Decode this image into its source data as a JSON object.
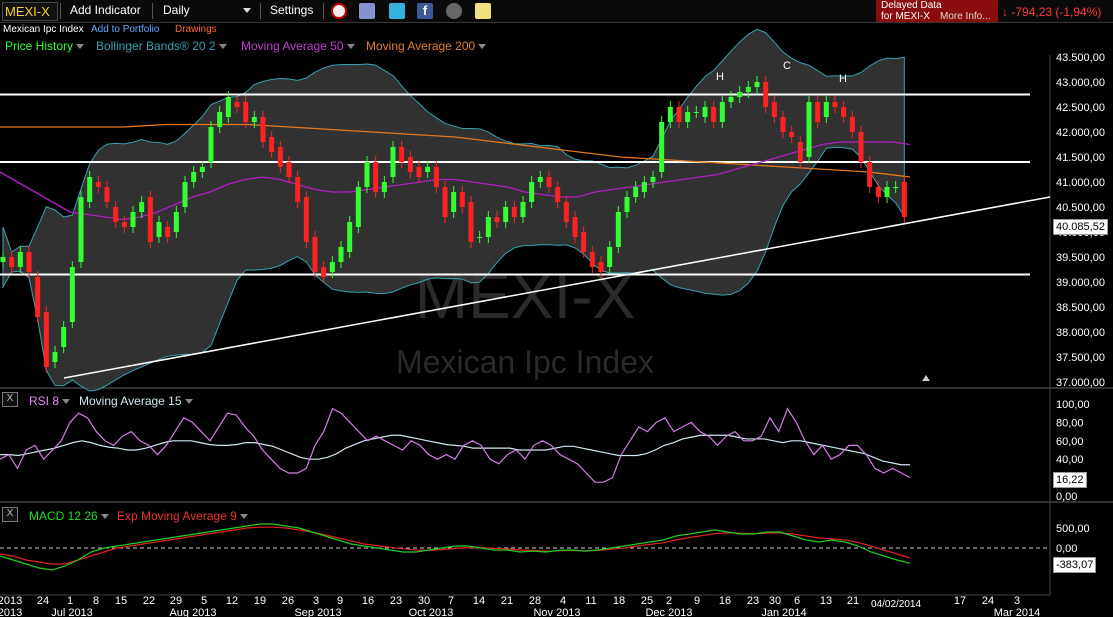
{
  "toolbar": {
    "symbol": "MEXI-X",
    "add_indicator": "Add Indicator",
    "interval": "Daily",
    "settings": "Settings"
  },
  "subheader": {
    "name": "Mexican Ipc Index",
    "add_portfolio": "Add to Portfolio",
    "drawings": "Drawings"
  },
  "delayed": {
    "line1": "Delayed Data",
    "line2": "for MEXI-X",
    "more": "More Info..."
  },
  "change": "-794,23 (-1,94%)",
  "legend": {
    "price": "Price History",
    "bb": "Bollinger Bands® 20 2",
    "ma50": "Moving Average 50",
    "ma200": "Moving Average 200"
  },
  "watermark": {
    "symbol": "MEXI-X",
    "name": "Mexican Ipc Index"
  },
  "annotations": [
    "H",
    "C",
    "H"
  ],
  "rsi_panel": {
    "close": "X",
    "label": "RSI 8",
    "ma": "Moving Average 15"
  },
  "macd_panel": {
    "close": "X",
    "label": "MACD 12 26",
    "signal": "Exp Moving Average 9"
  },
  "last_labels": {
    "price": "40.085,52",
    "rsi": "16,22",
    "macd": "-383,07"
  },
  "cursor_date": "04/02/2014",
  "colors": {
    "up": "#33ff33",
    "down": "#ff2222",
    "ma50": "#b020c0",
    "ma200": "#e07820",
    "bb": "#3aa0b0",
    "rsi": "#d080e0",
    "rsi_ma": "#cfe8f0",
    "macd": "#22cc22",
    "signal": "#dd2222"
  },
  "chart_data": [
    {
      "type": "candlestick",
      "ylim": [
        37000,
        43500
      ],
      "y_ticks": [
        "43.500,00",
        "43.000,00",
        "42.500,00",
        "42.000,00",
        "41.500,00",
        "41.000,00",
        "40.500,00",
        "40.000,00",
        "39.500,00",
        "39.000,00",
        "38.500,00",
        "38.000,00",
        "37.500,00",
        "37.000,00"
      ],
      "x_ticks": [
        "2013",
        "24",
        "1",
        "8",
        "15",
        "22",
        "29",
        "5",
        "12",
        "19",
        "26",
        "3",
        "9",
        "16",
        "23",
        "30",
        "7",
        "14",
        "21",
        "28",
        "4",
        "11",
        "18",
        "25",
        "2",
        "9",
        "16",
        "23",
        "30",
        "6",
        "13",
        "21",
        "",
        "17",
        "24",
        "3"
      ],
      "month_labels": [
        "2013",
        "Jul 2013",
        "Aug 2013",
        "Sep 2013",
        "Oct 2013",
        "Nov 2013",
        "Dec 2013",
        "Jan 2014",
        "Mar 2014"
      ],
      "horizontal_levels": [
        42750,
        41400,
        39150
      ],
      "trendline": {
        "start_value": 37080,
        "end_value": 40700
      },
      "close": [
        39500,
        39300,
        39600,
        39200,
        38300,
        37300,
        37600,
        38100,
        39300,
        40700,
        41100,
        40900,
        40600,
        40200,
        40100,
        40400,
        40600,
        39800,
        40200,
        39900,
        40400,
        41000,
        41200,
        41300,
        42100,
        42400,
        42700,
        42500,
        42200,
        42300,
        41800,
        41600,
        41300,
        41100,
        40600,
        39800,
        39200,
        39100,
        39400,
        39700,
        40200,
        40900,
        41400,
        40800,
        41000,
        41700,
        41400,
        41200,
        41100,
        41300,
        40900,
        40300,
        40800,
        40500,
        39800,
        39900,
        40300,
        40200,
        40500,
        40300,
        40600,
        41000,
        41100,
        40900,
        40600,
        40200,
        39900,
        39600,
        39300,
        39200,
        39700,
        40400,
        40700,
        40900,
        41000,
        41100,
        42200,
        42500,
        42200,
        42400,
        42400,
        42500,
        42200,
        42600,
        42700,
        42800,
        42900,
        43000,
        42500,
        42300,
        42000,
        41900,
        41400,
        42600,
        42200,
        42600,
        42500,
        42300,
        42000,
        41400,
        40900,
        40700,
        40900,
        40900,
        40300
      ],
      "open": [
        39400,
        39500,
        39300,
        39600,
        39100,
        38400,
        37400,
        37700,
        38200,
        39400,
        40600,
        41000,
        40900,
        40500,
        40200,
        40100,
        40400,
        40700,
        39900,
        40100,
        40000,
        40500,
        41000,
        41200,
        41400,
        42100,
        42300,
        42600,
        42600,
        42200,
        42300,
        41900,
        41700,
        41400,
        41100,
        40700,
        39900,
        39300,
        39200,
        39400,
        39600,
        40100,
        40900,
        41400,
        40800,
        41100,
        41700,
        41500,
        41300,
        41200,
        41300,
        40900,
        40400,
        40800,
        40600,
        39900,
        39900,
        40300,
        40200,
        40500,
        40300,
        40600,
        41000,
        41100,
        40900,
        40600,
        40300,
        40000,
        39600,
        39400,
        39300,
        39700,
        40400,
        40700,
        40800,
        41000,
        41200,
        42200,
        42500,
        42200,
        42400,
        42300,
        42500,
        42200,
        42600,
        42700,
        42800,
        42900,
        43000,
        42600,
        42300,
        42000,
        41800,
        41500,
        42600,
        42300,
        42600,
        42500,
        42300,
        42000,
        41400,
        40900,
        40700,
        40900,
        41000
      ],
      "ma50": [
        41200,
        41000,
        40800,
        40600,
        40400,
        40350,
        40300,
        40250,
        40300,
        40400,
        40550,
        40700,
        40800,
        40950,
        41050,
        41100,
        41050,
        40950,
        40850,
        40800,
        40800,
        40850,
        40900,
        40950,
        41000,
        41050,
        41050,
        41000,
        40950,
        40900,
        40800,
        40750,
        40700,
        40700,
        40800,
        40850,
        40900,
        40950,
        41000,
        41050,
        41100,
        41150,
        41250,
        41350,
        41450,
        41550,
        41650,
        41750,
        41800,
        41800,
        41800,
        41800,
        41750
      ],
      "ma200": [
        42100,
        42100,
        42100,
        42100,
        42150,
        42150,
        42150,
        42100,
        42050,
        42000,
        41950,
        41900,
        41800,
        41700,
        41600,
        41500,
        41450,
        41400,
        41350,
        41300,
        41250,
        41200,
        41100
      ]
    },
    {
      "type": "line",
      "name": "RSI 8",
      "ylim": [
        0,
        100
      ],
      "y_ticks": [
        "100,00",
        "80,00",
        "60,00",
        "40,00",
        "20,00",
        "0,00"
      ],
      "rsi": [
        40,
        45,
        30,
        50,
        55,
        40,
        50,
        60,
        80,
        90,
        85,
        70,
        60,
        55,
        65,
        70,
        60,
        55,
        45,
        55,
        70,
        85,
        80,
        70,
        60,
        75,
        90,
        88,
        75,
        65,
        50,
        40,
        30,
        25,
        25,
        30,
        55,
        70,
        95,
        90,
        80,
        70,
        60,
        65,
        60,
        55,
        50,
        60,
        55,
        45,
        40,
        45,
        40,
        55,
        60,
        55,
        40,
        35,
        45,
        50,
        40,
        55,
        60,
        55,
        45,
        40,
        35,
        25,
        15,
        15,
        20,
        45,
        60,
        75,
        70,
        80,
        85,
        70,
        75,
        80,
        70,
        65,
        55,
        65,
        70,
        60,
        60,
        65,
        85,
        70,
        95,
        80,
        60,
        45,
        55,
        40,
        45,
        55,
        55,
        45,
        30,
        25,
        30,
        25,
        20
      ],
      "rsi_ma": [
        45,
        45,
        44,
        46,
        48,
        50,
        52,
        55,
        58,
        60,
        58,
        55,
        53,
        52,
        50,
        50,
        52,
        55,
        58,
        60,
        60,
        60,
        58,
        56,
        55,
        55,
        56,
        58,
        58,
        56,
        54,
        50,
        46,
        42,
        40,
        40,
        42,
        46,
        52,
        56,
        60,
        62,
        64,
        66,
        66,
        64,
        62,
        60,
        58,
        56,
        55,
        54,
        52,
        52,
        52,
        52,
        52,
        50,
        50,
        50,
        50,
        52,
        54,
        54,
        52,
        50,
        48,
        46,
        44,
        44,
        44,
        46,
        50,
        55,
        58,
        62,
        64,
        66,
        66,
        66,
        66,
        64,
        62,
        62,
        62,
        60,
        58,
        60,
        60,
        58,
        56,
        54,
        52,
        50,
        48,
        46,
        42,
        38,
        36,
        34,
        34
      ]
    },
    {
      "type": "line",
      "name": "MACD 12 26",
      "ylim": [
        -800,
        800
      ],
      "y_ticks": [
        "500,00",
        "0,00"
      ],
      "macd": [
        -200,
        -300,
        -400,
        -500,
        -550,
        -450,
        -300,
        -100,
        0,
        50,
        100,
        150,
        200,
        250,
        300,
        350,
        400,
        450,
        500,
        550,
        600,
        600,
        550,
        500,
        400,
        300,
        200,
        100,
        50,
        0,
        -50,
        -100,
        -100,
        -50,
        0,
        50,
        50,
        0,
        -50,
        -50,
        -100,
        -80,
        -100,
        -60,
        -50,
        -80,
        -50,
        0,
        50,
        100,
        150,
        200,
        300,
        350,
        400,
        450,
        400,
        350,
        350,
        400,
        400,
        300,
        200,
        150,
        200,
        150,
        50,
        -100,
        -200,
        -300,
        -383
      ],
      "signal": [
        -150,
        -200,
        -300,
        -350,
        -400,
        -400,
        -300,
        -200,
        -100,
        0,
        50,
        100,
        150,
        200,
        250,
        300,
        350,
        400,
        450,
        500,
        520,
        520,
        500,
        450,
        400,
        330,
        250,
        180,
        100,
        60,
        20,
        -20,
        -50,
        -60,
        -40,
        -10,
        10,
        10,
        -10,
        -20,
        -50,
        -60,
        -80,
        -70,
        -60,
        -70,
        -60,
        -30,
        0,
        50,
        90,
        130,
        200,
        260,
        310,
        360,
        380,
        370,
        360,
        370,
        380,
        350,
        300,
        250,
        230,
        200,
        140,
        50,
        -50,
        -150,
        -250
      ]
    }
  ]
}
